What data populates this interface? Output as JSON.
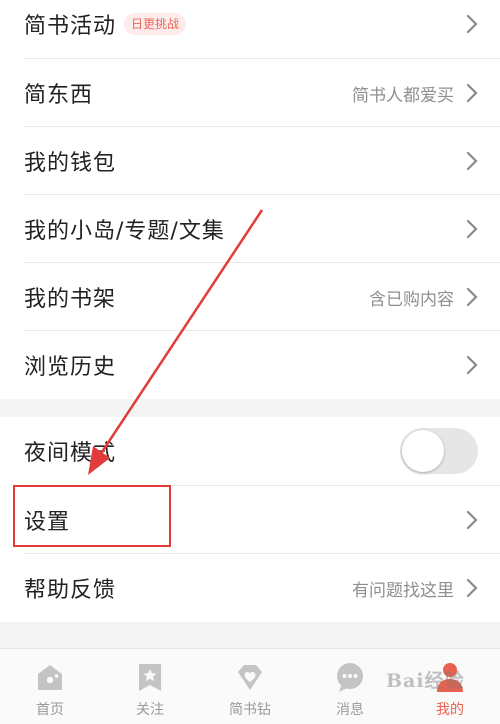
{
  "menu": {
    "activities": {
      "label": "简书活动",
      "badge": "日更挑战"
    },
    "jianshu_things": {
      "label": "简东西",
      "hint": "简书人都爱买"
    },
    "wallet": {
      "label": "我的钱包"
    },
    "islands": {
      "label": "我的小岛/专题/文集"
    },
    "bookshelf": {
      "label": "我的书架",
      "hint": "含已购内容"
    },
    "history": {
      "label": "浏览历史"
    },
    "night_mode": {
      "label": "夜间模式",
      "enabled": false
    },
    "settings": {
      "label": "设置"
    },
    "help": {
      "label": "帮助反馈",
      "hint": "有问题找这里"
    }
  },
  "tabbar": {
    "items": [
      {
        "label": "首页",
        "icon": "home-icon"
      },
      {
        "label": "关注",
        "icon": "star-bookmark-icon"
      },
      {
        "label": "简书钻",
        "icon": "diamond-heart-icon"
      },
      {
        "label": "消息",
        "icon": "message-icon"
      },
      {
        "label": "我的",
        "icon": "person-icon",
        "active": true
      }
    ]
  },
  "watermark": "Bai经验",
  "colors": {
    "accent": "#e9624f",
    "badge_bg": "#fdeceb",
    "highlight": "#e23b3b",
    "icon_gray": "#c4c4c4"
  }
}
